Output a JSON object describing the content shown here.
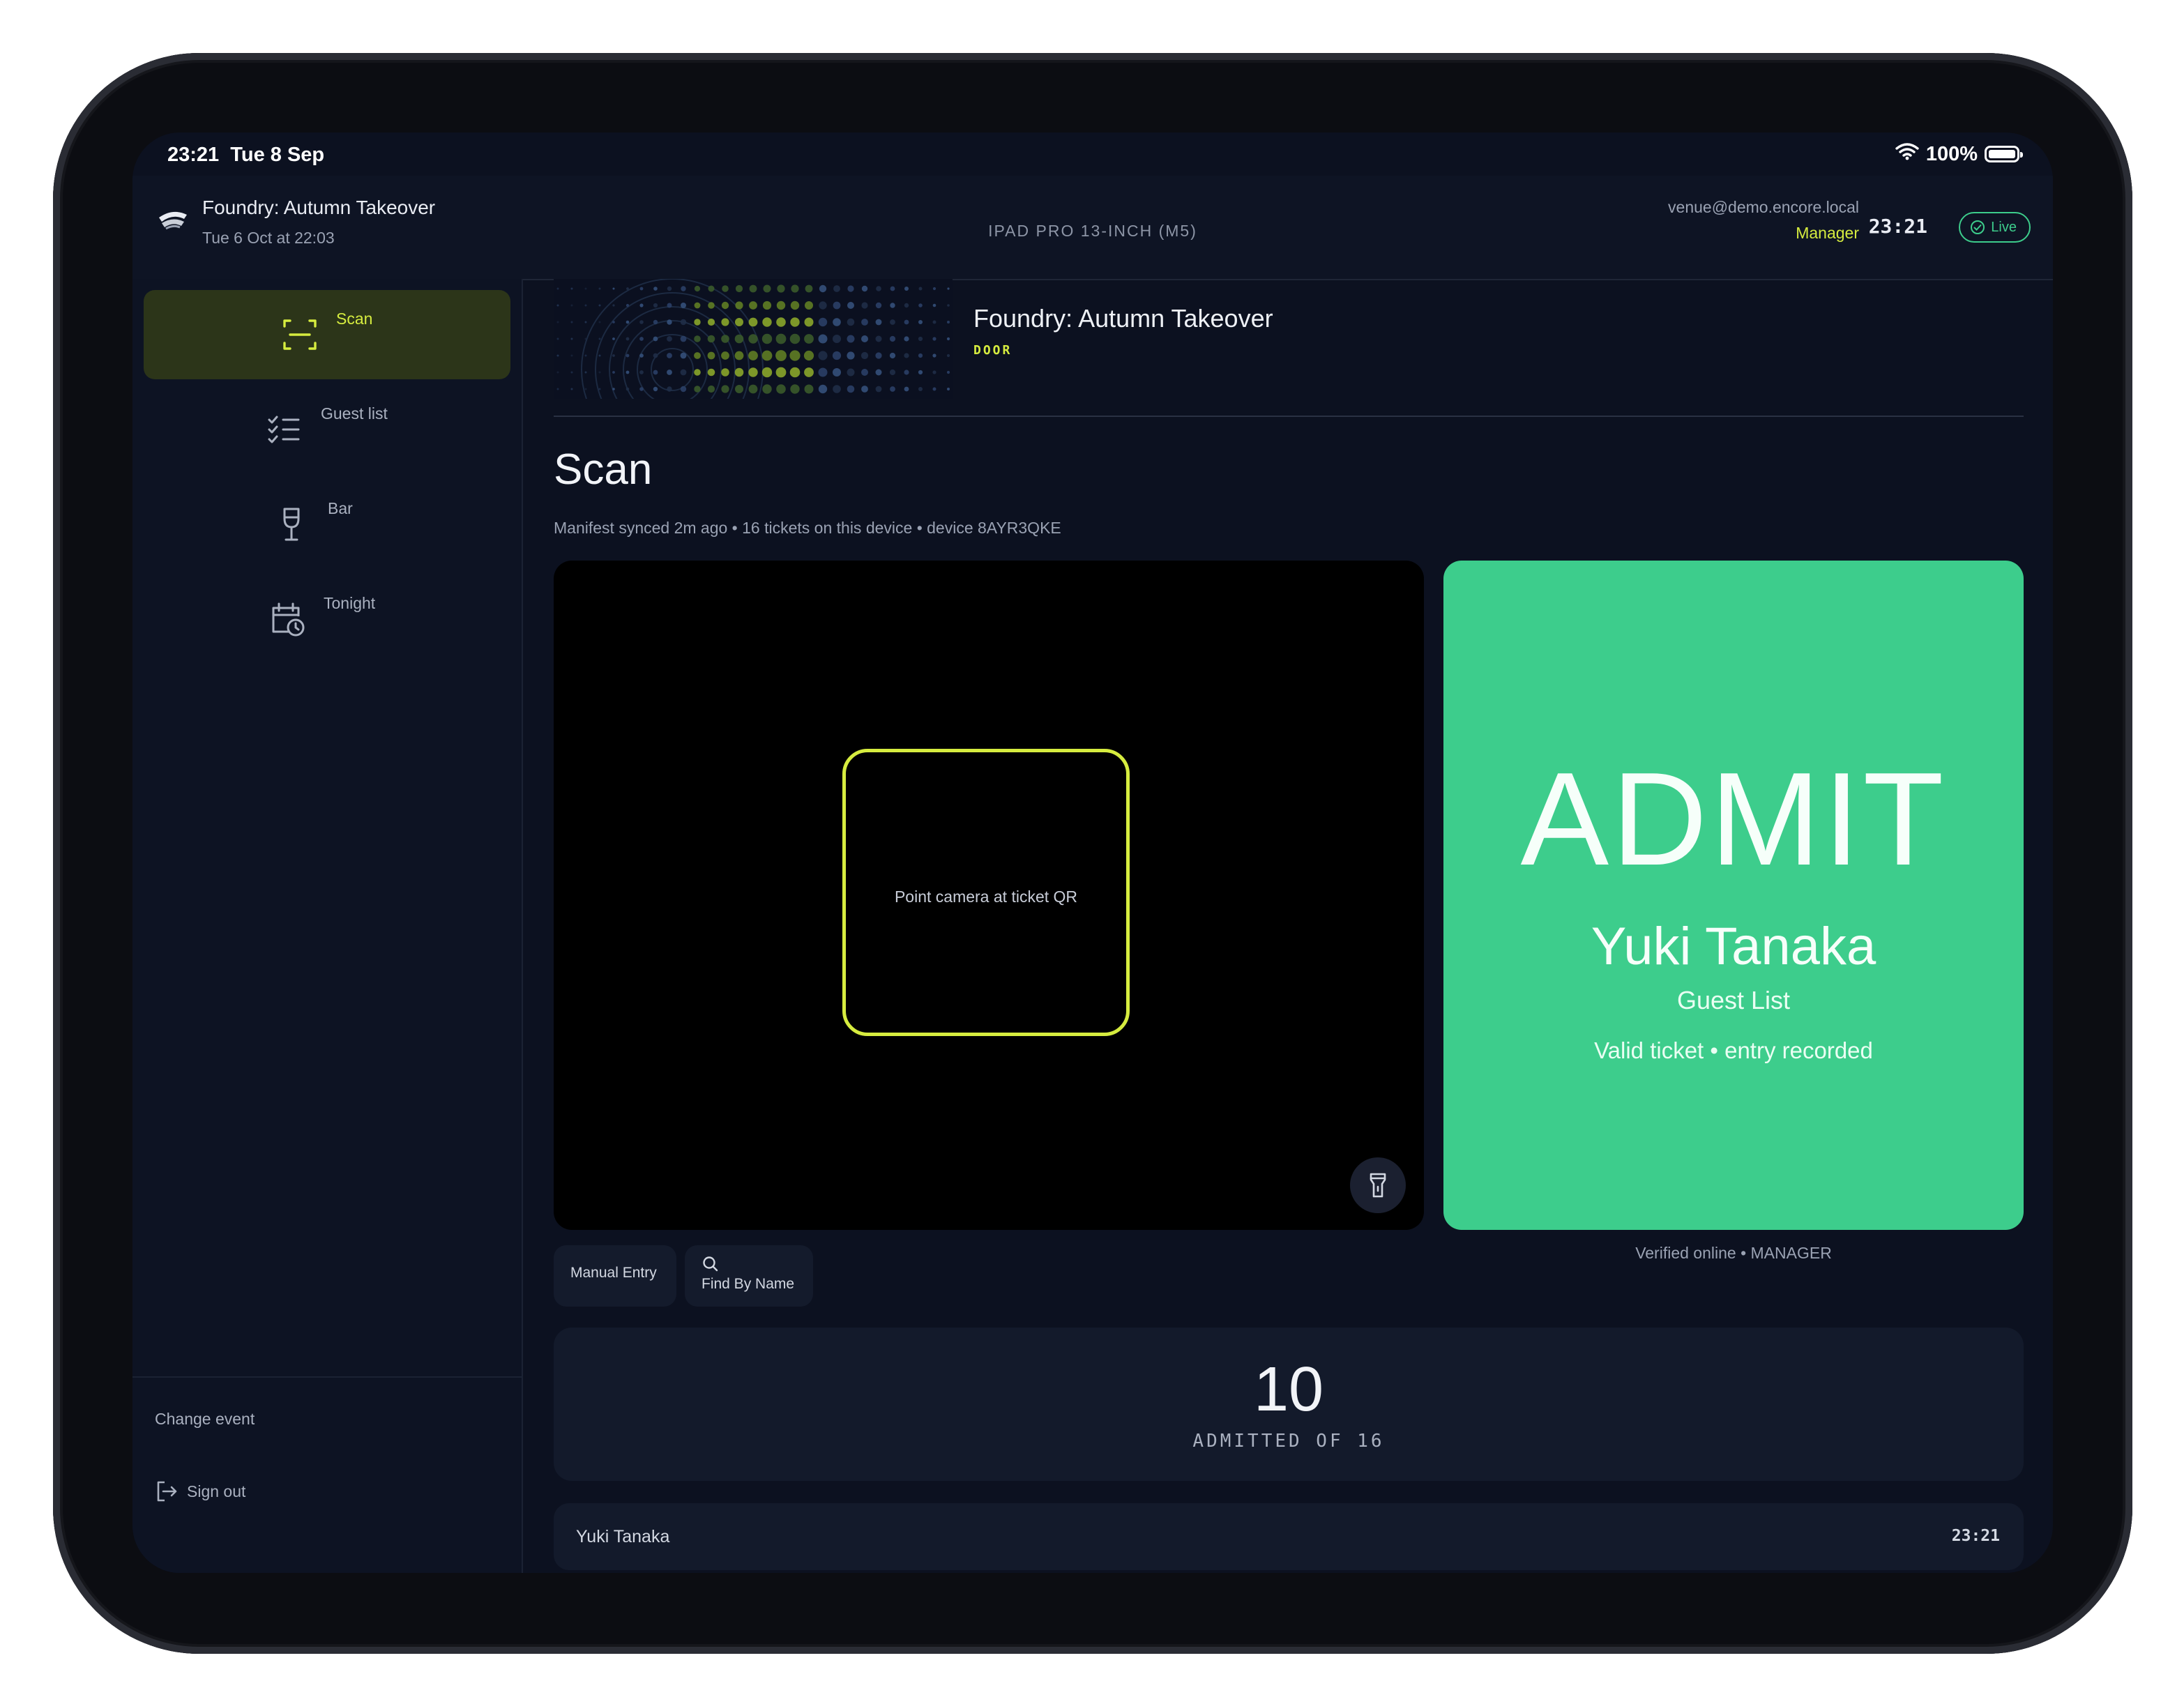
{
  "status_bar": {
    "time": "23:21",
    "date": "Tue 8 Sep",
    "battery": "100%",
    "battery_level": 1.0
  },
  "header": {
    "event_title": "Foundry: Autumn Takeover",
    "event_datetime": "Tue 6 Oct at 22:03",
    "device": "IPAD PRO 13-INCH (M5)",
    "user_email": "venue@demo.encore.local",
    "user_role": "Manager",
    "clock": "23:21",
    "live_label": "Live"
  },
  "sidebar": {
    "items": [
      {
        "label": "Scan",
        "icon": "scan-icon",
        "active": true
      },
      {
        "label": "Guest list",
        "icon": "checklist-icon",
        "active": false
      },
      {
        "label": "Bar",
        "icon": "wine-glass-icon",
        "active": false
      },
      {
        "label": "Tonight",
        "icon": "calendar-clock-icon",
        "active": false
      }
    ],
    "change_event": "Change event",
    "sign_out": "Sign out"
  },
  "event": {
    "title": "Foundry: Autumn Takeover",
    "tag": "DOOR"
  },
  "page": {
    "title": "Scan",
    "subtitle": "Manifest synced 2m ago • 16 tickets on this device • device 8AYR3QKE"
  },
  "scanner": {
    "hint": "Point camera at ticket QR"
  },
  "result": {
    "verdict": "ADMIT",
    "guest_name": "Yuki Tanaka",
    "guest_type": "Guest List",
    "status": "Valid ticket • entry recorded",
    "verified": "Verified online • MANAGER"
  },
  "actions": {
    "manual_entry": "Manual Entry",
    "find_by_name": "Find By Name"
  },
  "counter": {
    "admitted": "10",
    "label": "ADMITTED OF 16"
  },
  "log": [
    {
      "name": "Yuki Tanaka",
      "time": "23:21"
    }
  ],
  "colors": {
    "accent": "#d6ec3f",
    "admit": "#3dcd8c",
    "background": "#0c1120"
  }
}
